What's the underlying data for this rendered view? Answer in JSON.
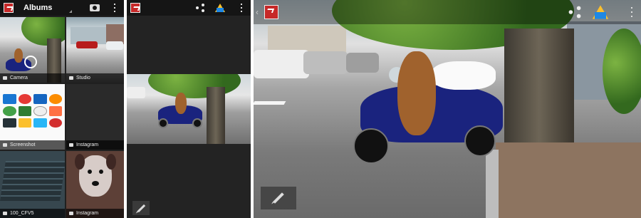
{
  "screen1": {
    "title": "Albums",
    "albums": [
      {
        "label": "Camera",
        "icon": "camera-icon"
      },
      {
        "label": "Studio",
        "icon": "folder-icon"
      },
      {
        "label": "Screenshot",
        "icon": "folder-icon"
      },
      {
        "label": "Instagram",
        "icon": "folder-icon"
      },
      {
        "label": "100_CFV5",
        "icon": "folder-icon"
      },
      {
        "label": "Instagram",
        "icon": "folder-icon"
      }
    ]
  },
  "icons": {
    "app_logo": "photo-editor-logo",
    "camera": "camera-icon",
    "share": "share-icon",
    "drive": "google-drive-icon",
    "overflow": "overflow-menu-icon",
    "edit": "pencil-icon"
  },
  "colors": {
    "actionbar": "#151515",
    "logo_red": "#c62828",
    "background": "#202020"
  }
}
